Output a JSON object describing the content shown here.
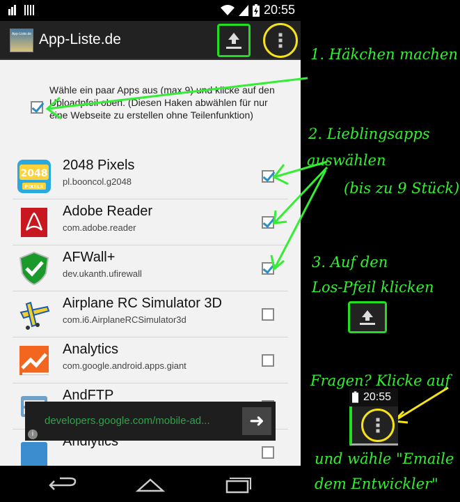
{
  "status_bar": {
    "time": "20:55"
  },
  "action_bar": {
    "logo_text": "App-Liste.de",
    "title": "App-Liste.de"
  },
  "intro": {
    "text": "Wähle ein paar Apps aus (max 9) und klicke auf den Uploadpfeil oben. (Diesen Haken abwählen für nur eine Webseite zu erstellen ohne Teilenfunktion)",
    "checked": true
  },
  "apps": [
    {
      "name": "2048 Pixels",
      "package": "pl.booncol.g2048",
      "checked": true
    },
    {
      "name": "Adobe Reader",
      "package": "com.adobe.reader",
      "checked": true
    },
    {
      "name": "AFWall+",
      "package": "dev.ukanth.ufirewall",
      "checked": true
    },
    {
      "name": "Airplane RC Simulator 3D",
      "package": "com.i6.AirplaneRCSimulator3d",
      "checked": false
    },
    {
      "name": "Analytics",
      "package": "com.google.android.apps.giant",
      "checked": false
    },
    {
      "name": "AndFTP",
      "package": "",
      "checked": false
    },
    {
      "name": "Andlytics",
      "package": "",
      "checked": false
    }
  ],
  "ad": {
    "url": "developers.google.com/mobile-ad..."
  },
  "annotations": {
    "step1": "1. Häkchen machen",
    "step2_line1": "2. Lieblingsapps",
    "step2_line2": "auswählen",
    "step2_line3": "(bis zu 9 Stück)",
    "step3_line1": "3. Auf den",
    "step3_line2": "Los-Pfeil klicken",
    "questions": "Fragen? Klicke auf",
    "mini_time": "20:55",
    "choose_line1": "und wähle \"Emaile",
    "choose_line2": "dem Entwickler\""
  },
  "colors": {
    "annotation_green": "#33ee33",
    "annotation_yellow": "#f5e31a",
    "checkbox_blue": "#2a8ec7"
  }
}
